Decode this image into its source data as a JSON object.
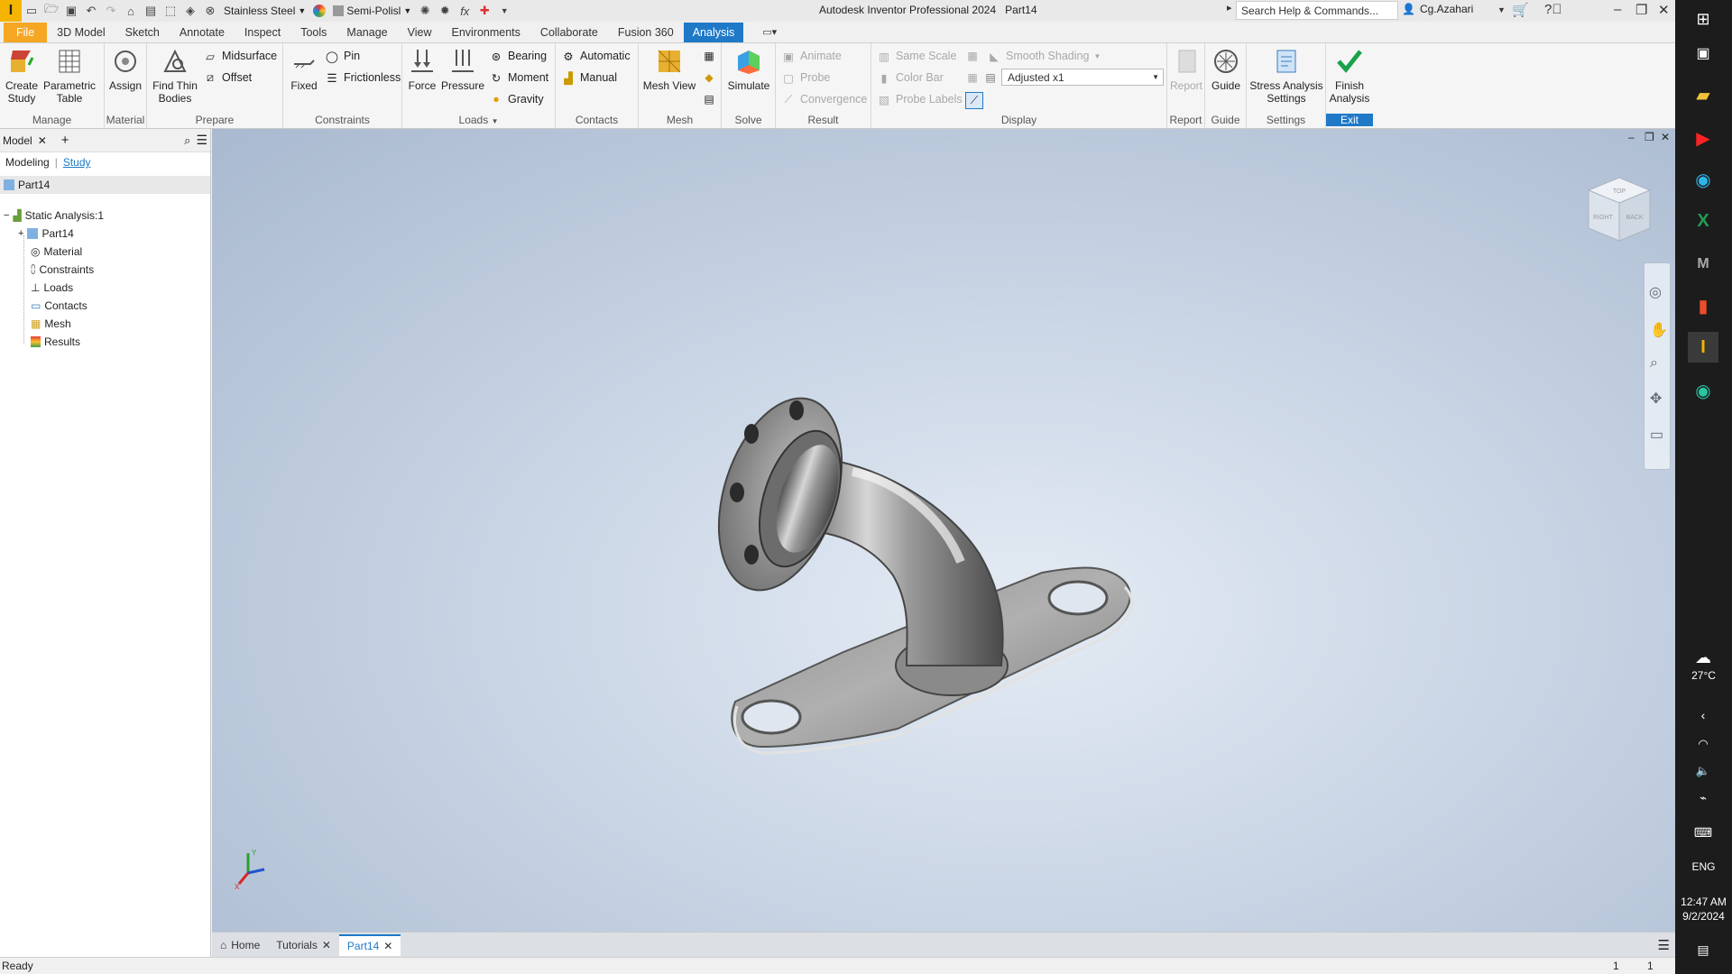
{
  "titlebar": {
    "app_title": "Autodesk Inventor Professional 2024",
    "doc_title": "Part14",
    "material": "Stainless Steel",
    "appearance": "Semi-Polisl",
    "search_placeholder": "Search Help & Commands...",
    "user": "Cg.Azahari"
  },
  "menu": {
    "tabs": [
      "File",
      "3D Model",
      "Sketch",
      "Annotate",
      "Inspect",
      "Tools",
      "Manage",
      "View",
      "Environments",
      "Collaborate",
      "Fusion 360",
      "Analysis"
    ],
    "active": "Analysis"
  },
  "ribbon": {
    "manage": {
      "label": "Manage",
      "create_study": "Create Study",
      "parametric_table": "Parametric Table"
    },
    "material": {
      "label": "Material",
      "assign": "Assign"
    },
    "prepare": {
      "label": "Prepare",
      "find_thin_bodies": "Find Thin Bodies",
      "midsurface": "Midsurface",
      "offset": "Offset"
    },
    "constraints": {
      "label": "Constraints",
      "fixed": "Fixed",
      "pin": "Pin",
      "frictionless": "Frictionless"
    },
    "loads": {
      "label": "Loads",
      "force": "Force",
      "pressure": "Pressure",
      "bearing": "Bearing",
      "moment": "Moment",
      "gravity": "Gravity"
    },
    "contacts": {
      "label": "Contacts",
      "automatic": "Automatic",
      "manual": "Manual"
    },
    "mesh": {
      "label": "Mesh",
      "mesh_view": "Mesh View"
    },
    "solve": {
      "label": "Solve",
      "simulate": "Simulate"
    },
    "result": {
      "label": "Result",
      "animate": "Animate",
      "probe": "Probe",
      "convergence": "Convergence"
    },
    "display": {
      "label": "Display",
      "same_scale": "Same Scale",
      "color_bar": "Color Bar",
      "probe_labels": "Probe Labels",
      "smooth_shading": "Smooth Shading",
      "adjusted": "Adjusted x1"
    },
    "report": {
      "label": "Report",
      "report": "Report"
    },
    "guide": {
      "label": "Guide",
      "guide": "Guide"
    },
    "settings": {
      "label": "Settings",
      "stress_settings": "Stress Analysis Settings"
    },
    "exit": {
      "label": "Exit",
      "finish": "Finish Analysis"
    }
  },
  "browser": {
    "tab_model": "Model",
    "modeling": "Modeling",
    "study": "Study",
    "root": "Part14",
    "tree": [
      "Static Analysis:1",
      "Part14",
      "Material",
      "Constraints",
      "Loads",
      "Contacts",
      "Mesh",
      "Results"
    ]
  },
  "viewcube": {
    "right": "RIGHT",
    "back": "BACK",
    "top": "TOP"
  },
  "doc_tabs": {
    "home": "Home",
    "tutorials": "Tutorials",
    "part": "Part14"
  },
  "status": {
    "text": "Ready",
    "count1": "1",
    "count2": "1"
  },
  "taskbar": {
    "temp": "27°C",
    "lang": "ENG",
    "time": "12:47 AM",
    "date": "9/2/2024"
  },
  "colors": {
    "accent": "#1f79c7",
    "file_tab": "#f5a623",
    "finish_check": "#1aa24a"
  }
}
